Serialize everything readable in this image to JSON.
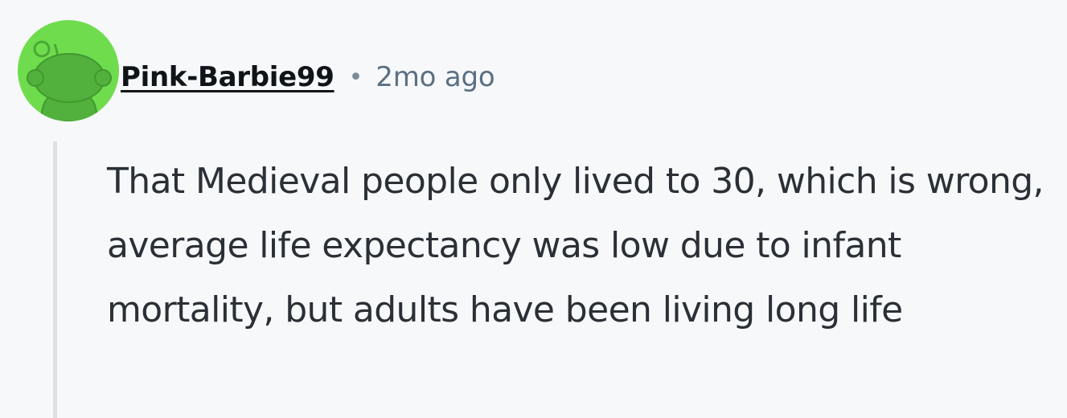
{
  "comment": {
    "author": "Pink-Barbie99",
    "separator": "•",
    "timestamp": "2mo ago",
    "body": "That Medieval people only lived to 30, which is wrong, average life expectancy was low due to infant mortality, but adults have been living long life"
  },
  "avatar": {
    "icon": "snoo-avatar-icon",
    "background_color": "#6fdc4e",
    "figure_color": "#4aa836"
  }
}
